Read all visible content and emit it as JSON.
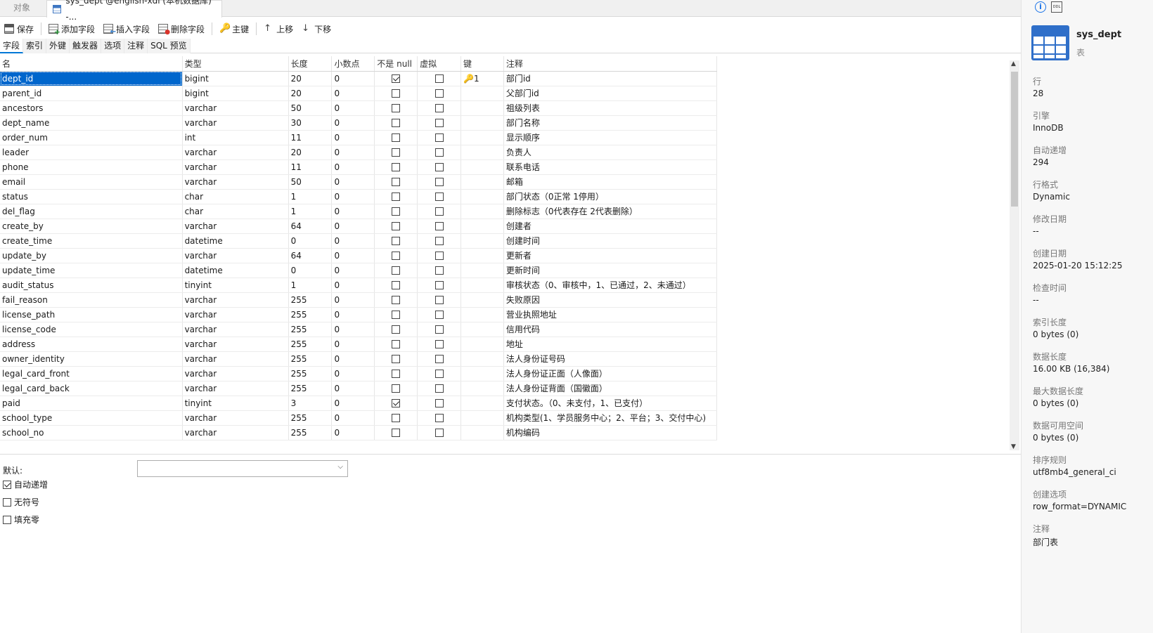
{
  "tabs": {
    "object_label": "对象",
    "active_label": "sys_dept @english-xdl (本机数据库) -..."
  },
  "toolbar": {
    "save": "保存",
    "add_field": "添加字段",
    "insert_field": "插入字段",
    "delete_field": "删除字段",
    "primary_key": "主键",
    "move_up": "上移",
    "move_down": "下移"
  },
  "subtabs": [
    "字段",
    "索引",
    "外键",
    "触发器",
    "选项",
    "注释",
    "SQL 预览"
  ],
  "columns": {
    "name": "名",
    "type": "类型",
    "length": "长度",
    "decimals": "小数点",
    "not_null": "不是 null",
    "virtual": "虚拟",
    "key": "键",
    "comment": "注释"
  },
  "fields": [
    {
      "name": "dept_id",
      "type": "bigint",
      "length": "20",
      "decimals": "0",
      "not_null": true,
      "virtual": false,
      "key": "1",
      "comment": "部门id"
    },
    {
      "name": "parent_id",
      "type": "bigint",
      "length": "20",
      "decimals": "0",
      "not_null": false,
      "virtual": false,
      "key": "",
      "comment": "父部门id"
    },
    {
      "name": "ancestors",
      "type": "varchar",
      "length": "50",
      "decimals": "0",
      "not_null": false,
      "virtual": false,
      "key": "",
      "comment": "祖级列表"
    },
    {
      "name": "dept_name",
      "type": "varchar",
      "length": "30",
      "decimals": "0",
      "not_null": false,
      "virtual": false,
      "key": "",
      "comment": "部门名称"
    },
    {
      "name": "order_num",
      "type": "int",
      "length": "11",
      "decimals": "0",
      "not_null": false,
      "virtual": false,
      "key": "",
      "comment": "显示顺序"
    },
    {
      "name": "leader",
      "type": "varchar",
      "length": "20",
      "decimals": "0",
      "not_null": false,
      "virtual": false,
      "key": "",
      "comment": "负责人"
    },
    {
      "name": "phone",
      "type": "varchar",
      "length": "11",
      "decimals": "0",
      "not_null": false,
      "virtual": false,
      "key": "",
      "comment": "联系电话"
    },
    {
      "name": "email",
      "type": "varchar",
      "length": "50",
      "decimals": "0",
      "not_null": false,
      "virtual": false,
      "key": "",
      "comment": "邮箱"
    },
    {
      "name": "status",
      "type": "char",
      "length": "1",
      "decimals": "0",
      "not_null": false,
      "virtual": false,
      "key": "",
      "comment": "部门状态（0正常 1停用）"
    },
    {
      "name": "del_flag",
      "type": "char",
      "length": "1",
      "decimals": "0",
      "not_null": false,
      "virtual": false,
      "key": "",
      "comment": "删除标志（0代表存在 2代表删除）"
    },
    {
      "name": "create_by",
      "type": "varchar",
      "length": "64",
      "decimals": "0",
      "not_null": false,
      "virtual": false,
      "key": "",
      "comment": "创建者"
    },
    {
      "name": "create_time",
      "type": "datetime",
      "length": "0",
      "decimals": "0",
      "not_null": false,
      "virtual": false,
      "key": "",
      "comment": "创建时间"
    },
    {
      "name": "update_by",
      "type": "varchar",
      "length": "64",
      "decimals": "0",
      "not_null": false,
      "virtual": false,
      "key": "",
      "comment": "更新者"
    },
    {
      "name": "update_time",
      "type": "datetime",
      "length": "0",
      "decimals": "0",
      "not_null": false,
      "virtual": false,
      "key": "",
      "comment": "更新时间"
    },
    {
      "name": "audit_status",
      "type": "tinyint",
      "length": "1",
      "decimals": "0",
      "not_null": false,
      "virtual": false,
      "key": "",
      "comment": "审核状态（0、审核中，1、已通过，2、未通过）"
    },
    {
      "name": "fail_reason",
      "type": "varchar",
      "length": "255",
      "decimals": "0",
      "not_null": false,
      "virtual": false,
      "key": "",
      "comment": "失败原因"
    },
    {
      "name": "license_path",
      "type": "varchar",
      "length": "255",
      "decimals": "0",
      "not_null": false,
      "virtual": false,
      "key": "",
      "comment": "营业执照地址"
    },
    {
      "name": "license_code",
      "type": "varchar",
      "length": "255",
      "decimals": "0",
      "not_null": false,
      "virtual": false,
      "key": "",
      "comment": "信用代码"
    },
    {
      "name": "address",
      "type": "varchar",
      "length": "255",
      "decimals": "0",
      "not_null": false,
      "virtual": false,
      "key": "",
      "comment": "地址"
    },
    {
      "name": "owner_identity",
      "type": "varchar",
      "length": "255",
      "decimals": "0",
      "not_null": false,
      "virtual": false,
      "key": "",
      "comment": "法人身份证号码"
    },
    {
      "name": "legal_card_front",
      "type": "varchar",
      "length": "255",
      "decimals": "0",
      "not_null": false,
      "virtual": false,
      "key": "",
      "comment": "法人身份证正面（人像面）"
    },
    {
      "name": "legal_card_back",
      "type": "varchar",
      "length": "255",
      "decimals": "0",
      "not_null": false,
      "virtual": false,
      "key": "",
      "comment": "法人身份证背面（国徽面）"
    },
    {
      "name": "paid",
      "type": "tinyint",
      "length": "3",
      "decimals": "0",
      "not_null": true,
      "virtual": false,
      "key": "",
      "comment": "支付状态。（0、未支付，1、已支付）"
    },
    {
      "name": "school_type",
      "type": "varchar",
      "length": "255",
      "decimals": "0",
      "not_null": false,
      "virtual": false,
      "key": "",
      "comment": "机构类型(1、学员服务中心；2、平台；3、交付中心)"
    },
    {
      "name": "school_no",
      "type": "varchar",
      "length": "255",
      "decimals": "0",
      "not_null": false,
      "virtual": false,
      "key": "",
      "comment": "机构编码"
    }
  ],
  "properties": {
    "default_label": "默认:",
    "default_value": "",
    "auto_increment": {
      "label": "自动递增",
      "checked": true
    },
    "unsigned": {
      "label": "无符号",
      "checked": false
    },
    "zerofill": {
      "label": "填充零",
      "checked": false
    }
  },
  "sidebar": {
    "title": "sys_dept",
    "subtitle": "表",
    "items": [
      {
        "label": "行",
        "value": "28"
      },
      {
        "label": "引擎",
        "value": "InnoDB"
      },
      {
        "label": "自动递增",
        "value": "294"
      },
      {
        "label": "行格式",
        "value": "Dynamic"
      },
      {
        "label": "修改日期",
        "value": "--"
      },
      {
        "label": "创建日期",
        "value": "2025-01-20 15:12:25"
      },
      {
        "label": "检查时间",
        "value": "--"
      },
      {
        "label": "索引长度",
        "value": "0 bytes (0)"
      },
      {
        "label": "数据长度",
        "value": "16.00 KB (16,384)"
      },
      {
        "label": "最大数据长度",
        "value": "0 bytes (0)"
      },
      {
        "label": "数据可用空间",
        "value": "0 bytes (0)"
      },
      {
        "label": "排序规则",
        "value": "utf8mb4_general_ci"
      },
      {
        "label": "创建选项",
        "value": "row_format=DYNAMIC"
      },
      {
        "label": "注释",
        "value": "部门表"
      }
    ]
  },
  "icons": {
    "info": "info-icon",
    "ddl": "ddl-icon",
    "table": "table-icon"
  },
  "colors": {
    "selection": "#0066cc",
    "accent": "#2f6fc9",
    "key": "#d4a017"
  }
}
